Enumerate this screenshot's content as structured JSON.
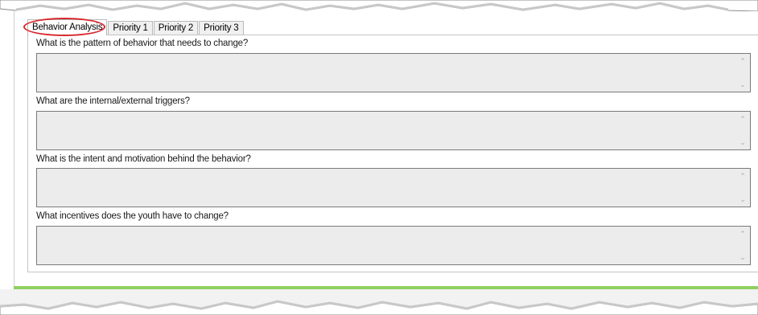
{
  "tabs": [
    {
      "label": "Behavior Analysis",
      "active": true
    },
    {
      "label": "Priority 1",
      "active": false
    },
    {
      "label": "Priority 2",
      "active": false
    },
    {
      "label": "Priority 3",
      "active": false
    }
  ],
  "questions": [
    {
      "label": "What is the pattern of behavior that needs to change?",
      "value": ""
    },
    {
      "label": "What are the internal/external triggers?",
      "value": ""
    },
    {
      "label": "What is the intent and motivation behind the behavior?",
      "value": ""
    },
    {
      "label": "What incentives does the youth have to change?",
      "value": ""
    }
  ],
  "colors": {
    "highlight_circle": "#d9262b",
    "field_background": "#ececec",
    "accent_bar": "#8fcf62"
  },
  "icons": [
    "scroll-up-icon",
    "scroll-down-icon"
  ]
}
